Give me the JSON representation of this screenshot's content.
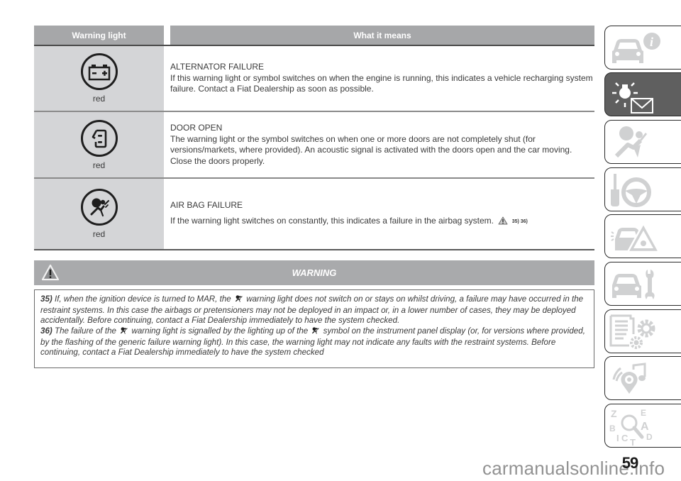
{
  "table": {
    "headers": {
      "warning_light": "Warning light",
      "what_it_means": "What it means"
    },
    "rows": [
      {
        "icon": "battery-icon",
        "color": "red",
        "title": "ALTERNATOR FAILURE",
        "description": "If this warning light or symbol switches on when the engine is running, this indicates a vehicle recharging system failure. Contact a Fiat Dealership as soon as possible."
      },
      {
        "icon": "door-open-icon",
        "color": "red",
        "title": "DOOR OPEN",
        "description": "The warning light or the symbol switches on when one or more doors are not completely shut (for versions/markets, where provided). An acoustic signal is activated with the doors open and the car moving. Close the doors properly."
      },
      {
        "icon": "airbag-icon",
        "color": "red",
        "title": "AIR BAG FAILURE",
        "description": "If the warning light switches on constantly, this indicates a failure in the airbag system.",
        "footnote_refs": "35) 36)"
      }
    ]
  },
  "warning": {
    "title": "WARNING",
    "notes": [
      {
        "number": "35)",
        "text_before_icon": "If, when the ignition device is turned to MAR, the",
        "text_after_icon": "warning light does not switch on or stays on whilst driving, a failure may have occurred in the restraint systems. In this case the airbags or pretensioners may not be deployed in an impact or, in a lower number of cases, they may be deployed accidentally. Before continuing, contact a Fiat Dealership immediately to have the system checked."
      },
      {
        "number": "36)",
        "text_before_icon": "The failure of the",
        "text_middle": "warning light is signalled by the lighting up of the",
        "text_after_icon": "symbol on the instrument panel display (or, for versions where provided, by the flashing of the generic failure warning light). In this case, the warning light may not indicate any faults with the restraint systems. Before continuing, contact a Fiat Dealership immediately to have the system checked"
      }
    ]
  },
  "side_tabs": [
    {
      "name": "car-info",
      "icon": "car-info-icon",
      "active": false
    },
    {
      "name": "warning-lights-messages",
      "icon": "lamp-envelope-icon",
      "active": true
    },
    {
      "name": "safety",
      "icon": "airbag-seat-icon",
      "active": false
    },
    {
      "name": "starting-driving",
      "icon": "key-steering-wheel-icon",
      "active": false
    },
    {
      "name": "in-an-emergency",
      "icon": "breakdown-triangle-icon",
      "active": false
    },
    {
      "name": "servicing-care",
      "icon": "car-wrench-icon",
      "active": false
    },
    {
      "name": "technical-data",
      "icon": "list-gears-icon",
      "active": false
    },
    {
      "name": "multimedia",
      "icon": "music-location-icon",
      "active": false
    },
    {
      "name": "index",
      "icon": "alphabet-magnifier-icon",
      "active": false
    }
  ],
  "page": {
    "number": "59",
    "watermark": "carmanualsonline.info"
  },
  "colors": {
    "header_gray": "#a6a7a9",
    "icon_cell_gray": "#d4d5d7",
    "warning_bar_gray": "#a9aaac",
    "active_tab": "#5f5f5f",
    "tab_icon_gray": "#cfd0d1"
  }
}
